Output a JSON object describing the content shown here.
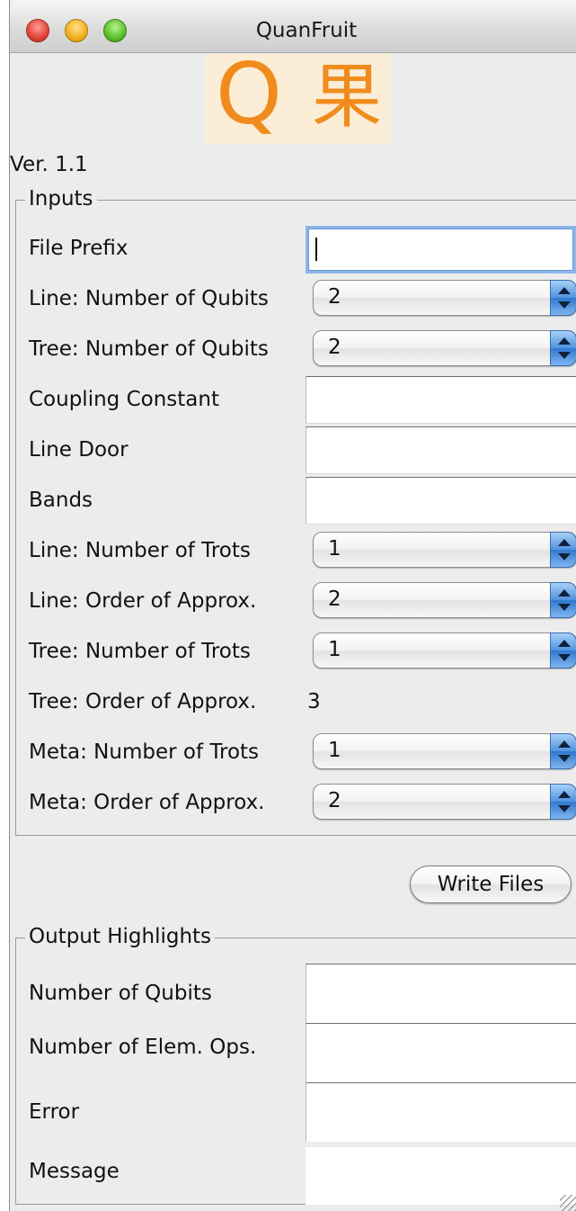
{
  "window": {
    "title": "QuanFruit",
    "logo": {
      "latin": "Q",
      "kanji": "果"
    },
    "version": "Ver. 1.1"
  },
  "inputs": {
    "legend": "Inputs",
    "file_prefix": {
      "label": "File Prefix",
      "value": ""
    },
    "line_qubits": {
      "label": "Line: Number of Qubits",
      "value": "2"
    },
    "tree_qubits": {
      "label": "Tree: Number of Qubits",
      "value": "2"
    },
    "coupling_constant": {
      "label": "Coupling Constant",
      "value": ""
    },
    "line_door": {
      "label": "Line Door",
      "value": ""
    },
    "bands": {
      "label": "Bands",
      "value": ""
    },
    "line_trots": {
      "label": "Line: Number of Trots",
      "value": "1"
    },
    "line_order": {
      "label": "Line: Order of Approx.",
      "value": "2"
    },
    "tree_trots": {
      "label": "Tree: Number of Trots",
      "value": "1"
    },
    "tree_order": {
      "label": "Tree: Order of Approx.",
      "value": "3"
    },
    "meta_trots": {
      "label": "Meta: Number of Trots",
      "value": "1"
    },
    "meta_order": {
      "label": "Meta: Order of Approx.",
      "value": "2"
    }
  },
  "write_button": "Write Files",
  "outputs": {
    "legend": "Output Highlights",
    "qubits": {
      "label": "Number of Qubits",
      "value": ""
    },
    "elem_ops": {
      "label": "Number of Elem. Ops.",
      "value": ""
    },
    "error": {
      "label": "Error",
      "value": ""
    },
    "message": {
      "label": "Message",
      "value": ""
    }
  },
  "colors": {
    "logo_orange": "#f08c1d",
    "logo_bg": "#fbedd6",
    "stepper_blue": "#4e93e0",
    "focus_ring": "#8db6e8"
  },
  "icons": [
    "close-button-icon",
    "minimize-button-icon",
    "zoom-button-icon",
    "popup-stepper-icon",
    "grow-box-icon"
  ]
}
